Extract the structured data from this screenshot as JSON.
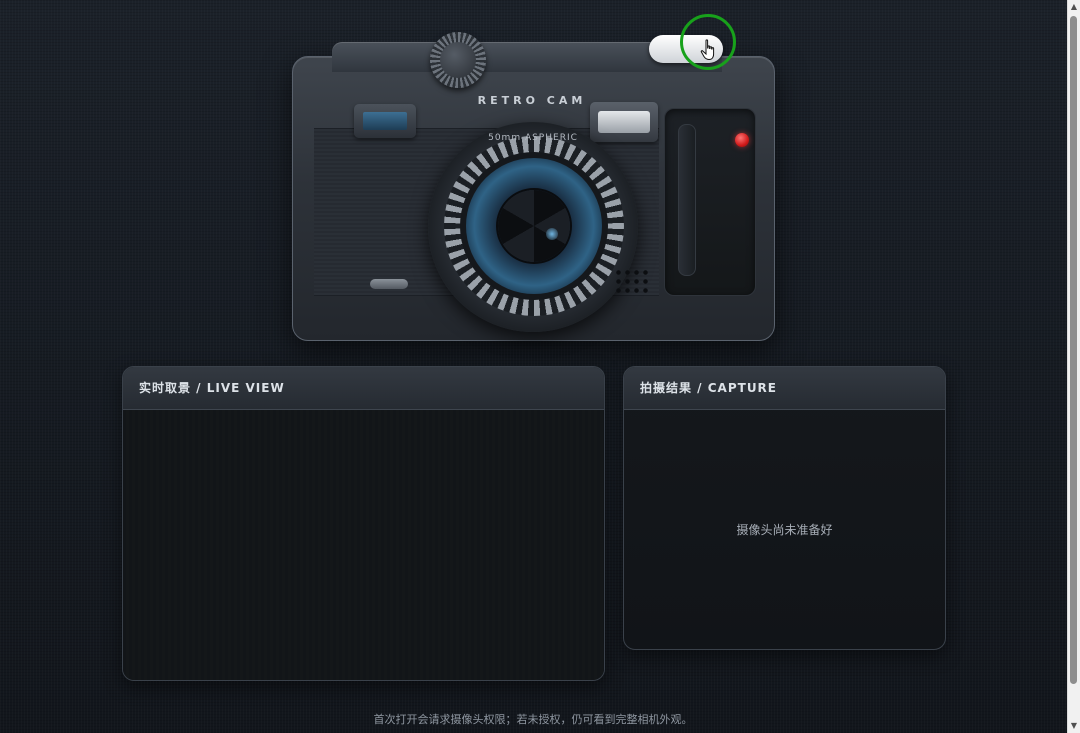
{
  "camera": {
    "brand": "RETRO CAM",
    "lens_text": "50mm ASPHERIC"
  },
  "panels": {
    "live": {
      "title": "实时取景 / LIVE VIEW"
    },
    "capture": {
      "title": "拍摄结果 / CAPTURE",
      "placeholder": "摄像头尚未准备好"
    }
  },
  "footer": {
    "note": "首次打开会请求摄像头权限；若未授权，仍可看到完整相机外观。"
  },
  "colors": {
    "background": "#161b22",
    "rec_indicator": "#e52222",
    "lens_blue": "#2f6386",
    "click_ring": "#18a11b"
  },
  "icons": {
    "cursor": "hand-pointer-icon",
    "scroll_up": "triangle-up-icon",
    "scroll_down": "triangle-down-icon"
  }
}
